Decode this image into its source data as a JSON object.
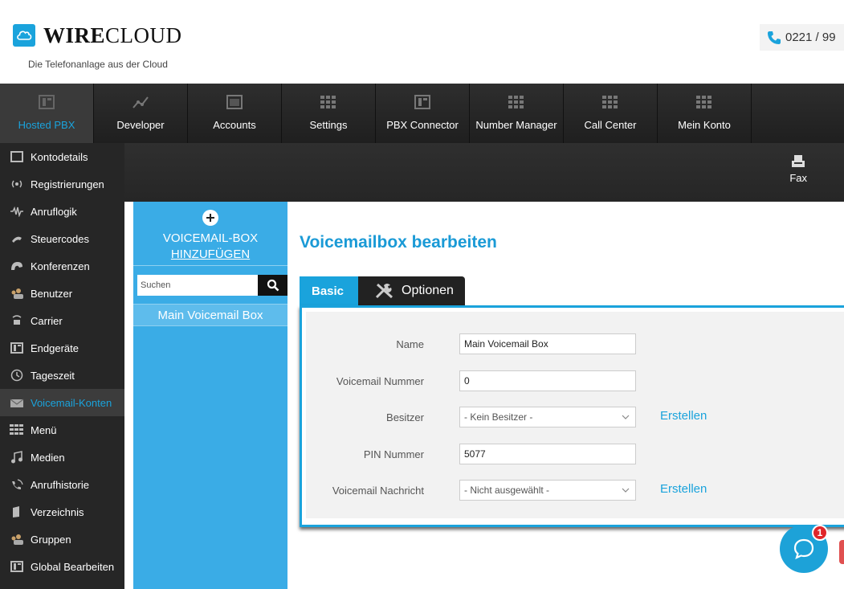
{
  "header": {
    "brand_bold": "WIRE",
    "brand_light": "CLOUD",
    "tagline": "Die Telefonanlage aus der Cloud",
    "phone": "0221 / 99"
  },
  "topnav": {
    "items": [
      {
        "label": "Hosted PBX",
        "active": true
      },
      {
        "label": "Developer"
      },
      {
        "label": "Accounts"
      },
      {
        "label": "Settings"
      },
      {
        "label": "PBX Connector"
      },
      {
        "label": "Number Manager"
      },
      {
        "label": "Call Center"
      },
      {
        "label": "Mein Konto"
      }
    ]
  },
  "subbar": {
    "fax_label": "Fax"
  },
  "sidebar": {
    "items": [
      {
        "label": "Kontodetails",
        "icon": "window-icon"
      },
      {
        "label": "Registrierungen",
        "icon": "signal-icon"
      },
      {
        "label": "Anruflogik",
        "icon": "waveform-icon"
      },
      {
        "label": "Steuercodes",
        "icon": "handset-icon"
      },
      {
        "label": "Konferenzen",
        "icon": "conference-icon"
      },
      {
        "label": "Benutzer",
        "icon": "users-icon"
      },
      {
        "label": "Carrier",
        "icon": "carrier-icon"
      },
      {
        "label": "Endgeräte",
        "icon": "device-icon"
      },
      {
        "label": "Tageszeit",
        "icon": "clock-icon"
      },
      {
        "label": "Voicemail-Konten",
        "icon": "envelope-icon",
        "active": true
      },
      {
        "label": "Menü",
        "icon": "grid-icon"
      },
      {
        "label": "Medien",
        "icon": "music-icon"
      },
      {
        "label": "Anrufhistorie",
        "icon": "history-icon"
      },
      {
        "label": "Verzeichnis",
        "icon": "book-icon"
      },
      {
        "label": "Gruppen",
        "icon": "group-icon"
      },
      {
        "label": "Global Bearbeiten",
        "icon": "edit-icon"
      }
    ]
  },
  "panel": {
    "add_line1": "VOICEMAIL-BOX",
    "add_line2": "HINZUFÜGEN",
    "search_placeholder": "Suchen",
    "selected_item": "Main Voicemail Box"
  },
  "main": {
    "title": "Voicemailbox bearbeiten",
    "tab_basic": "Basic",
    "tab_options": "Optionen",
    "form": {
      "name_label": "Name",
      "name_value": "Main Voicemail Box",
      "number_label": "Voicemail Nummer",
      "number_value": "0",
      "owner_label": "Besitzer",
      "owner_value": "- Kein Besitzer -",
      "owner_link": "Erstellen",
      "pin_label": "PIN Nummer",
      "pin_value": "5077",
      "message_label": "Voicemail Nachricht",
      "message_value": "- Nicht ausgewählt -",
      "message_link": "Erstellen"
    }
  },
  "chat": {
    "badge_count": "1"
  },
  "colors": {
    "accent": "#1aa3dc",
    "dark": "#262626",
    "panel": "#3aace6"
  }
}
